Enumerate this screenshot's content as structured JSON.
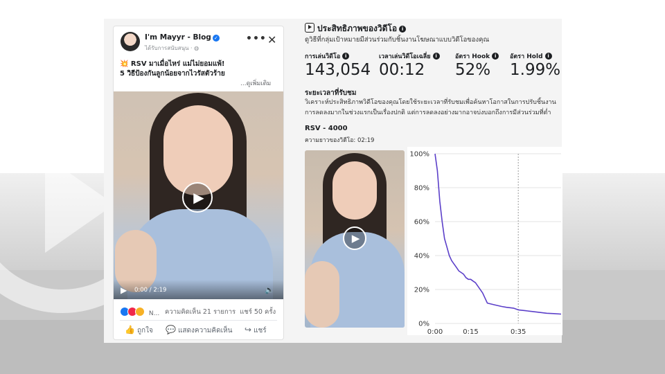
{
  "post": {
    "page_name": "I'm Mayyr - Blog",
    "sponsored": "ได้รับการสนับสนุน · ",
    "caption_line1": "💥 RSV มาเมื่อไหร่ แม่ไม่ยอมแพ้!",
    "caption_line2": "5 วิธีป้องกันลูกน้อยจากไวรัสตัวร้าย",
    "see_more": "...ดูเพิ่มเติม",
    "video_time": "0:00 / 2:19",
    "reaction_names": "N...",
    "comments": "ความคิดเห็น 21 รายการ",
    "shares": "แชร์ 50 ครั้ง",
    "like_label": "ถูกใจ",
    "comment_label": "แสดงความคิดเห็น",
    "share_label": "แชร์"
  },
  "analytics": {
    "title": "ประสิทธิภาพของวิดีโอ",
    "subtitle": "ดูวิธีที่กลุ่มเป้าหมายมีส่วนร่วมกับชิ้นงานโฆษณาแบบวิดีโอของคุณ",
    "metrics": [
      {
        "label": "การเล่นวิดีโอ",
        "value": "143,054"
      },
      {
        "label": "เวลาเล่นวิดีโอเฉลี่ย",
        "value": "00:12"
      },
      {
        "label": "อัตรา Hook",
        "value": "52%"
      },
      {
        "label": "อัตรา Hold",
        "value": "1.99%"
      }
    ],
    "retention_title": "ระยะเวลาที่รับชม",
    "retention_desc": "วิเคราะห์ประสิทธิภาพวิดีโอของคุณโดยใช้ระยะเวลาที่รับชมเพื่อค้นหาโอกาสในการปรับชิ้นงาน การลดลงมากในช่วงแรกเป็นเรื่องปกติ แต่การลดลงอย่างมากอาจบ่งบอกถึงการมีส่วนร่วมที่ต่ำ",
    "ad_name": "RSV - 4000",
    "video_length": "ความยาวของวิดีโอ: 02:19"
  },
  "colors": {
    "line": "#5b3fc9",
    "accent": "#1877f2"
  },
  "icons": [
    "avatar",
    "verified-icon",
    "more-icon",
    "close-icon",
    "play-icon",
    "volume-icon",
    "like-icon",
    "comment-icon",
    "share-icon",
    "video-icon",
    "info-icon"
  ],
  "chart_data": {
    "type": "line",
    "title": "",
    "xlabel": "",
    "ylabel": "",
    "x_ticks": [
      "0:00",
      "0:15",
      "0:35"
    ],
    "y_ticks": [
      "0%",
      "20%",
      "40%",
      "60%",
      "80%",
      "100%"
    ],
    "xlim": [
      0,
      53
    ],
    "ylim": [
      0,
      100
    ],
    "marker_x": 35,
    "grid": true,
    "series": [
      {
        "x": [
          0,
          1,
          2,
          3,
          4,
          5,
          6,
          7,
          8,
          9,
          10,
          11,
          12,
          13,
          14,
          15,
          16,
          17,
          18,
          20,
          22,
          25,
          28,
          30,
          33,
          35,
          38,
          41,
          44,
          47,
          50,
          53
        ],
        "y": [
          100,
          90,
          72,
          60,
          50,
          45,
          40,
          37,
          35,
          33,
          31,
          30,
          29,
          27,
          26,
          26,
          25,
          24,
          22,
          18,
          12,
          11,
          10,
          9.5,
          9,
          8,
          7.5,
          7,
          6.5,
          6,
          5.8,
          5.5
        ]
      }
    ]
  }
}
